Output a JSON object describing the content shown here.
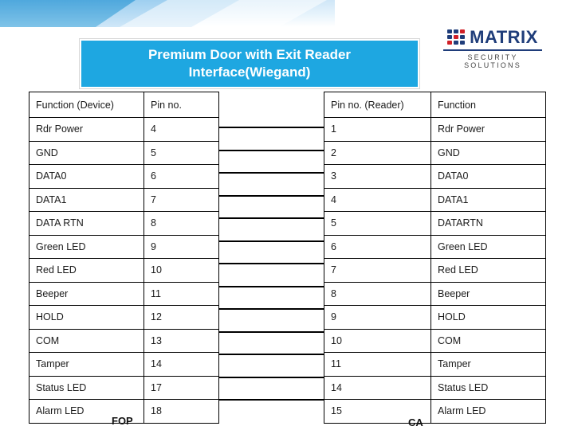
{
  "header": {
    "logo": {
      "word": "MATRIX",
      "tagline": "SECURITY SOLUTIONS",
      "mark_name": "matrix-dot-grid-logo"
    }
  },
  "title": {
    "line1": "Premium Door with Exit Reader",
    "line2": "Interface(Wiegand)",
    "background_color": "#1ea7e1",
    "text_color": "#ffffff"
  },
  "device_table": {
    "headers": [
      "Function (Device)",
      "Pin no."
    ],
    "rows": [
      {
        "function": "Rdr Power",
        "pin": "4"
      },
      {
        "function": "GND",
        "pin": "5"
      },
      {
        "function": "DATA0",
        "pin": "6"
      },
      {
        "function": "DATA1",
        "pin": "7"
      },
      {
        "function": "DATA RTN",
        "pin": "8"
      },
      {
        "function": "Green LED",
        "pin": "9"
      },
      {
        "function": "Red LED",
        "pin": "10"
      },
      {
        "function": "Beeper",
        "pin": "11"
      },
      {
        "function": "HOLD",
        "pin": "12"
      },
      {
        "function": "COM",
        "pin": "13"
      },
      {
        "function": "Tamper",
        "pin": "14"
      },
      {
        "function": "Status LED",
        "pin": "17"
      },
      {
        "function": "Alarm LED",
        "pin": "18"
      }
    ]
  },
  "reader_table": {
    "headers": [
      "Pin no. (Reader)",
      "Function"
    ],
    "rows": [
      {
        "pin": "1",
        "function": "Rdr Power"
      },
      {
        "pin": "2",
        "function": "GND"
      },
      {
        "pin": "3",
        "function": "DATA0"
      },
      {
        "pin": "4",
        "function": "DATA1"
      },
      {
        "pin": "5",
        "function": "DATARTN"
      },
      {
        "pin": "6",
        "function": "Green LED"
      },
      {
        "pin": "7",
        "function": "Red LED"
      },
      {
        "pin": "8",
        "function": "Beeper"
      },
      {
        "pin": "9",
        "function": "HOLD"
      },
      {
        "pin": "10",
        "function": "COM"
      },
      {
        "pin": "11",
        "function": "Tamper"
      },
      {
        "pin": "14",
        "function": "Status LED"
      },
      {
        "pin": "15",
        "function": "Alarm LED"
      }
    ]
  },
  "captions": {
    "left": "FOP",
    "right": "CA"
  },
  "wiring": {
    "connection_count": 13,
    "line_color": "#000000"
  }
}
